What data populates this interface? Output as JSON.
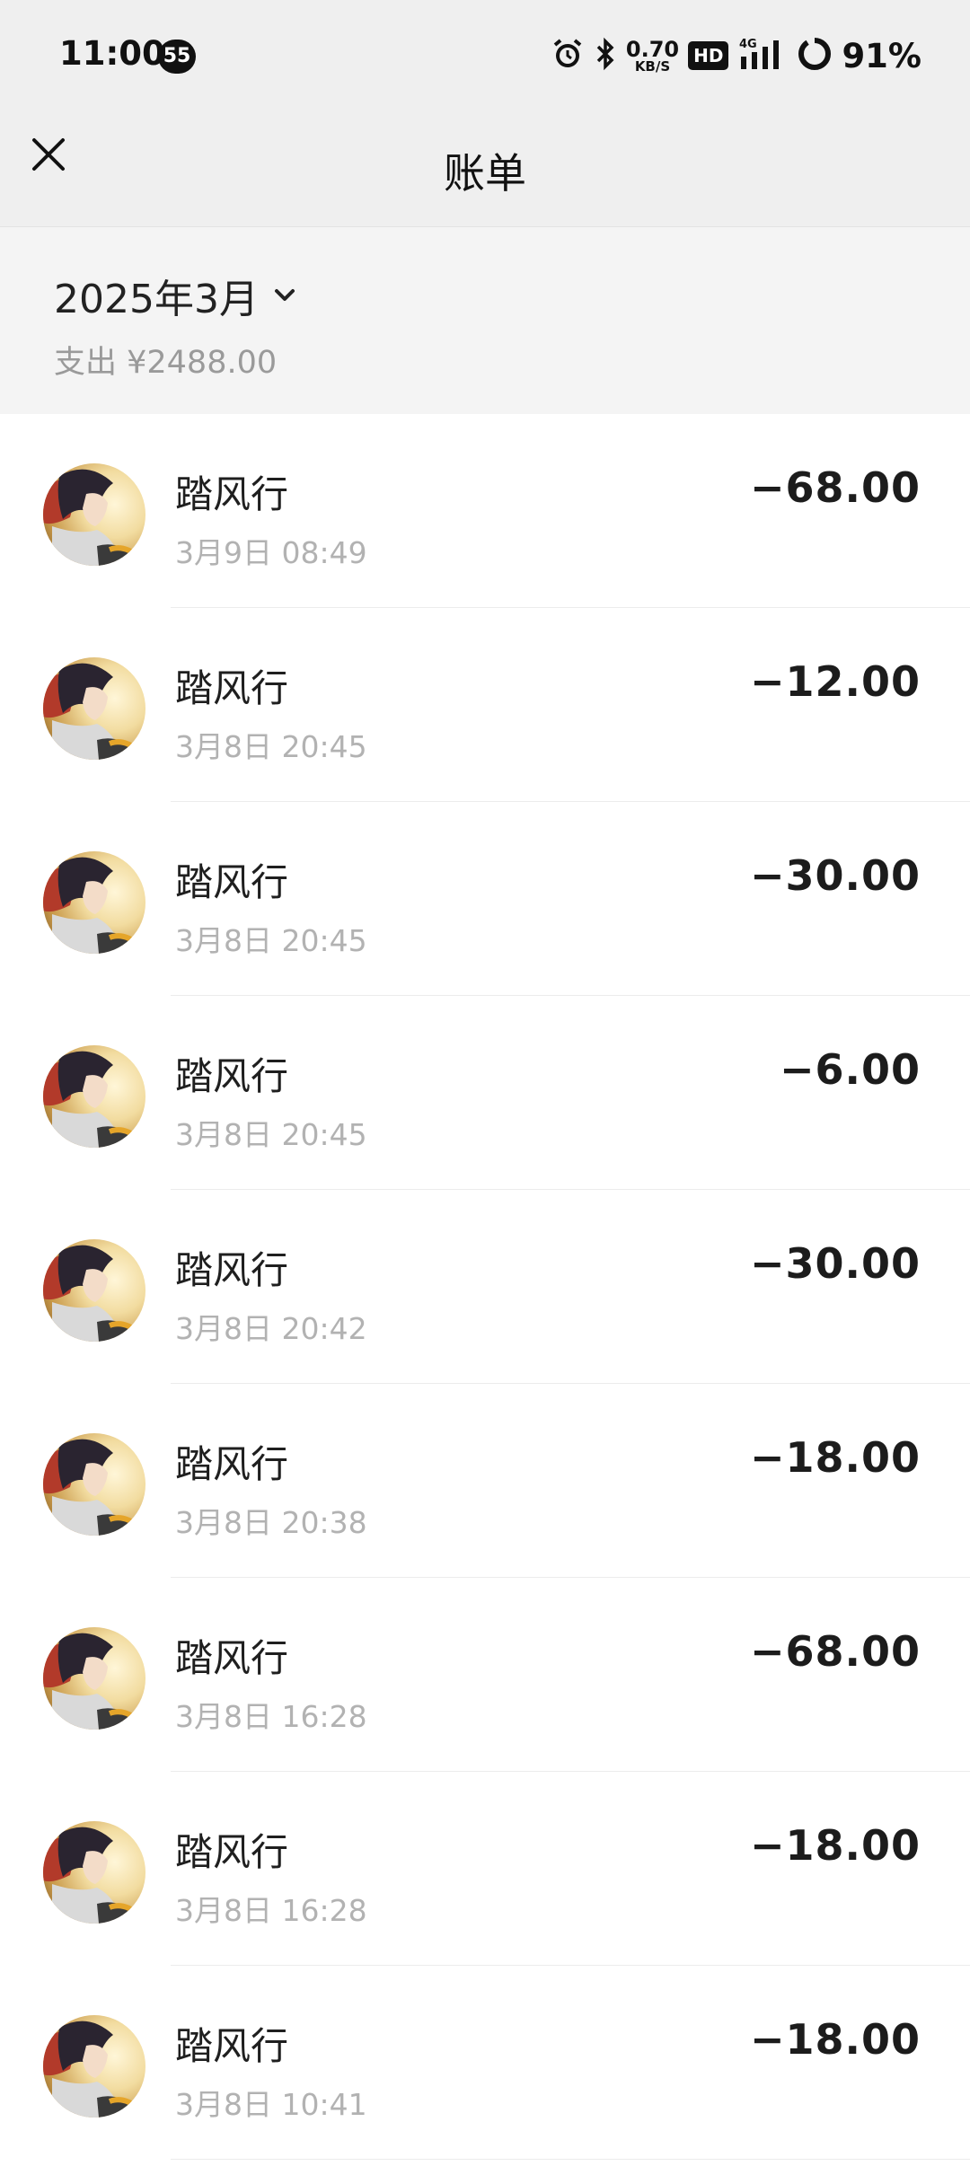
{
  "status_bar": {
    "time": "11:00",
    "notification_count": "55",
    "net_speed_value": "0.70",
    "net_speed_unit": "KB/S",
    "hd_label": "HD",
    "network_label": "4G",
    "battery": "91%"
  },
  "nav": {
    "title": "账单",
    "close_icon": "close-icon"
  },
  "summary": {
    "month": "2025年3月",
    "spend": "支出 ¥2488.00"
  },
  "transactions": [
    {
      "name": "踏风行",
      "time": "3月9日 08:49",
      "amount": "−68.00"
    },
    {
      "name": "踏风行",
      "time": "3月8日 20:45",
      "amount": "−12.00"
    },
    {
      "name": "踏风行",
      "time": "3月8日 20:45",
      "amount": "−30.00"
    },
    {
      "name": "踏风行",
      "time": "3月8日 20:45",
      "amount": "−6.00"
    },
    {
      "name": "踏风行",
      "time": "3月8日 20:42",
      "amount": "−30.00"
    },
    {
      "name": "踏风行",
      "time": "3月8日 20:38",
      "amount": "−18.00"
    },
    {
      "name": "踏风行",
      "time": "3月8日 16:28",
      "amount": "−68.00"
    },
    {
      "name": "踏风行",
      "time": "3月8日 16:28",
      "amount": "−18.00"
    },
    {
      "name": "踏风行",
      "time": "3月8日 10:41",
      "amount": "−18.00"
    }
  ],
  "colors": {
    "header_bg": "#efefef",
    "summary_bg": "#f4f4f4",
    "secondary_text": "#b2b2b2"
  }
}
